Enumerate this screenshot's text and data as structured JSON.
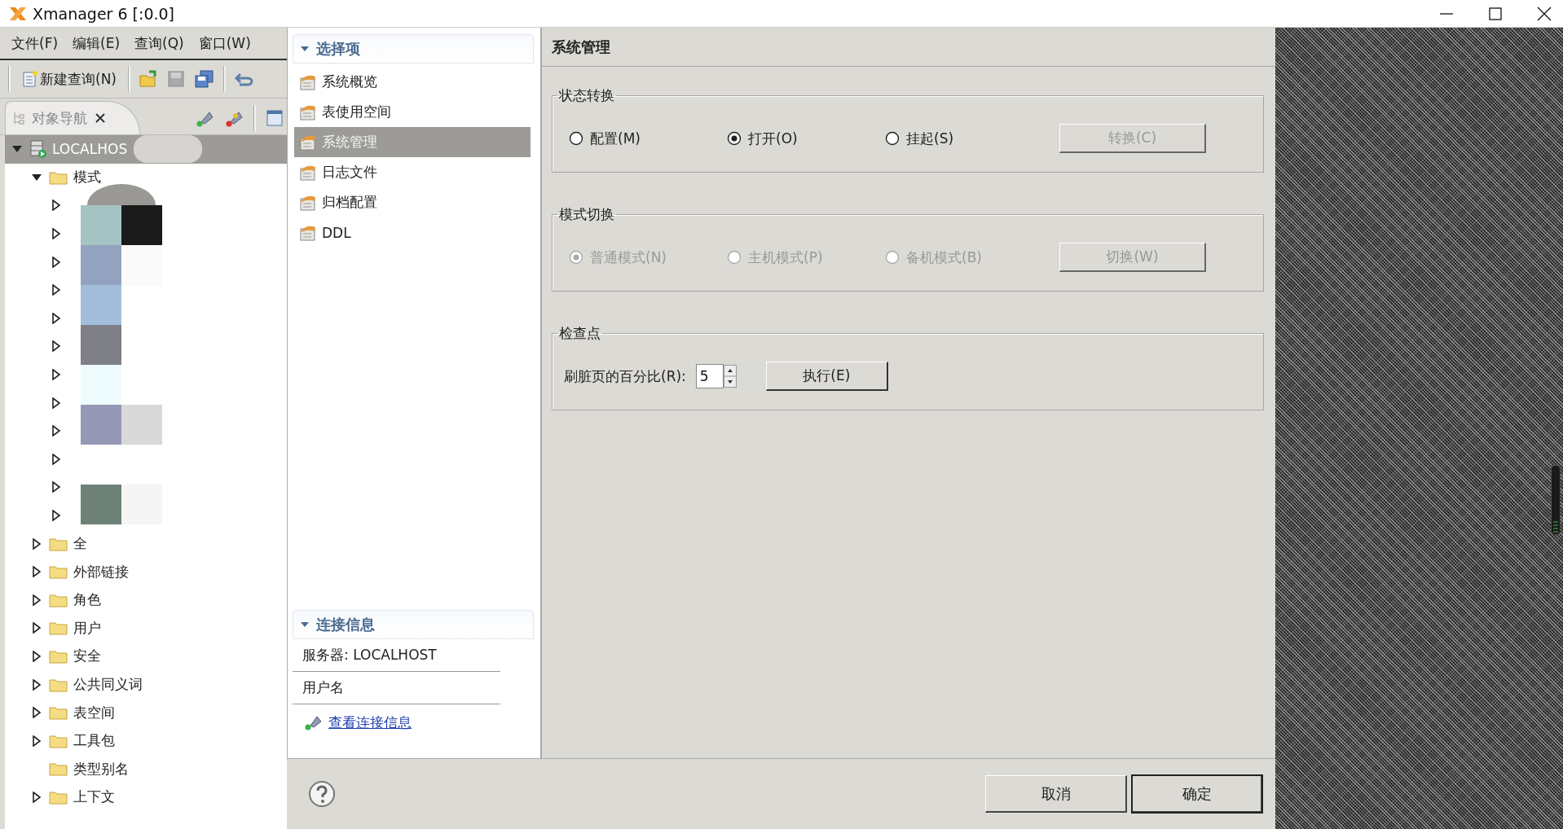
{
  "window": {
    "title": "Xmanager 6 [:0.0]"
  },
  "menu": [
    "文件(F)",
    "编辑(E)",
    "查询(Q)",
    "窗口(W)"
  ],
  "toolbar": {
    "new_query": "新建查询(N)"
  },
  "nav_tab": {
    "label": "对象导航",
    "selected": true
  },
  "tree": [
    {
      "label": "LOCALHOS",
      "expanded": true,
      "selected": true,
      "children": [
        {
          "label": "模式",
          "expanded": true,
          "children": [
            {
              "expanded": false
            },
            {
              "expanded": false
            },
            {
              "expanded": false
            },
            {
              "expanded": false
            },
            {
              "expanded": false
            },
            {
              "expanded": false
            },
            {
              "expanded": false
            },
            {
              "expanded": false
            },
            {
              "expanded": false
            },
            {
              "expanded": false
            },
            {
              "expanded": false
            },
            {
              "expanded": false
            }
          ]
        },
        {
          "label": "全",
          "expanded": false
        },
        {
          "label": "外部链接",
          "expanded": false
        },
        {
          "label": "角色",
          "expanded": false
        },
        {
          "label": "用户",
          "expanded": false
        },
        {
          "label": "安全",
          "expanded": false
        },
        {
          "label": "公共同义词",
          "expanded": false
        },
        {
          "label": "表空间",
          "expanded": false
        },
        {
          "label": "工具包",
          "expanded": false
        },
        {
          "label": "类型别名",
          "kind": "leaf"
        },
        {
          "label": "上下文",
          "expanded": false
        }
      ]
    }
  ],
  "options": {
    "title": "选择项",
    "expanded": true,
    "items": [
      {
        "label": "系统概览",
        "selected": false
      },
      {
        "label": "表使用空间",
        "selected": false
      },
      {
        "label": "系统管理",
        "selected": true
      },
      {
        "label": "日志文件",
        "selected": false
      },
      {
        "label": "归档配置",
        "selected": false
      },
      {
        "label": "DDL",
        "selected": false
      }
    ]
  },
  "connection": {
    "title": "连接信息",
    "expanded": true,
    "server": "服务器: LOCALHOST",
    "user": "用户名",
    "link": "查看连接信息"
  },
  "panel": {
    "title": "系统管理",
    "groups": [
      {
        "kind": "radios",
        "title": "状态转换",
        "disabled": false,
        "radios": [
          {
            "label": "配置(M)",
            "selected": false
          },
          {
            "label": "打开(O)",
            "selected": true
          },
          {
            "label": "挂起(S)",
            "selected": false
          }
        ],
        "button": {
          "label": "转换(C)",
          "disabled": true
        }
      },
      {
        "kind": "radios",
        "title": "模式切换",
        "disabled": true,
        "radios": [
          {
            "label": "普通模式(N)",
            "selected": true
          },
          {
            "label": "主机模式(P)",
            "selected": false
          },
          {
            "label": "备机模式(B)",
            "selected": false
          }
        ],
        "button": {
          "label": "切换(W)",
          "disabled": true
        }
      },
      {
        "kind": "spinner",
        "title": "检查点",
        "label": "刷脏页的百分比(R):",
        "value": "5",
        "button": {
          "label": "执行(E)",
          "disabled": false
        }
      }
    ]
  },
  "footer": {
    "buttons": [
      {
        "label": "取消",
        "default": false
      },
      {
        "label": "确定",
        "default": true
      }
    ]
  }
}
